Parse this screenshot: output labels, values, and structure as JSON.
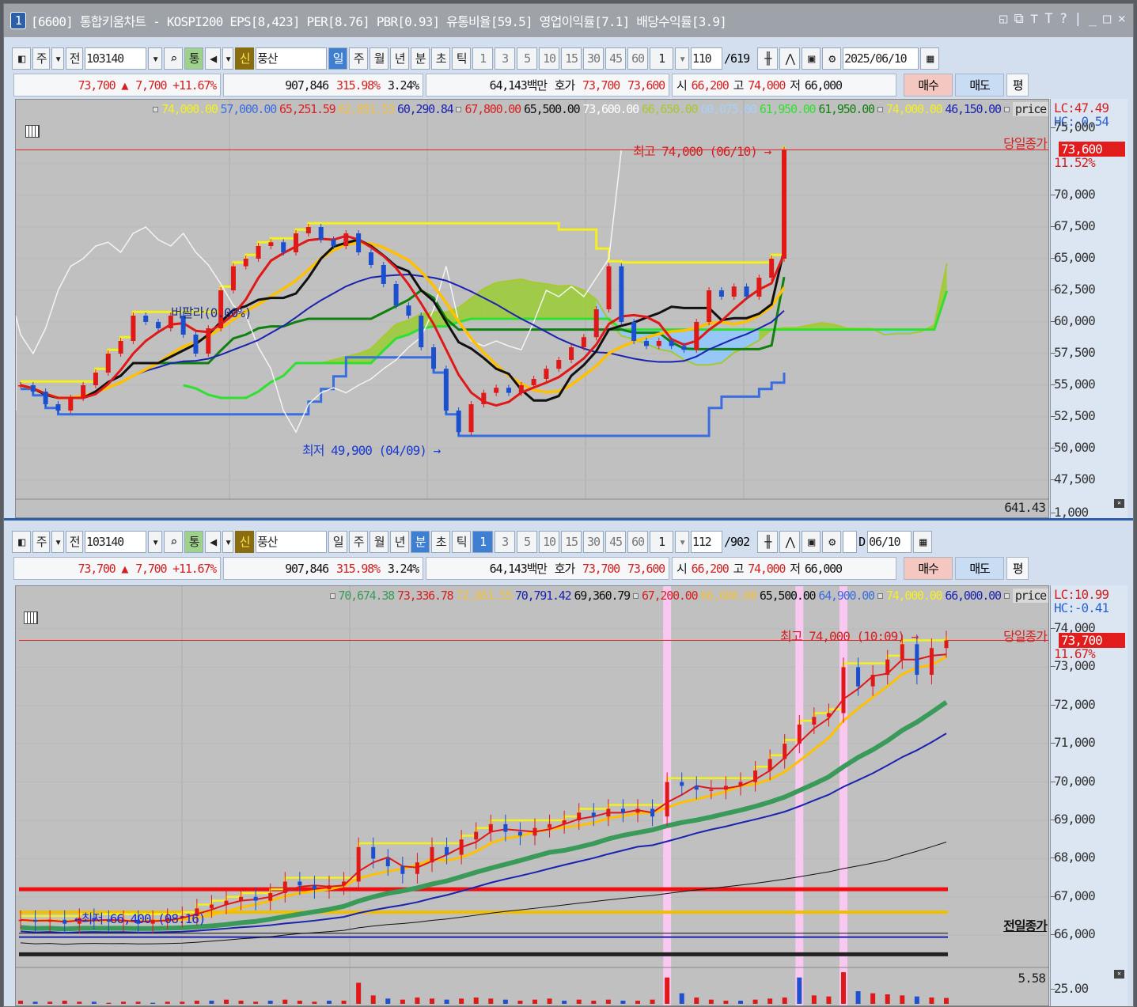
{
  "title": {
    "num": "1",
    "text": "[6600] 통합키움차트 - KOSPI200 EPS[8,423] PER[8.76] PBR[0.93] 유통비율[59.5] 영업이익률[7.1] 배당수익률[3.9]",
    "controls": [
      "◱",
      "⧉",
      "⊤",
      "T",
      "?",
      "|",
      "_",
      "□",
      "×"
    ]
  },
  "top": {
    "toolbar": {
      "market": "주",
      "all": "전",
      "code": "103140",
      "tong": "통",
      "sin": "신",
      "name": "풍산",
      "periods": [
        "일",
        "주",
        "월",
        "년",
        "분",
        "초",
        "틱"
      ],
      "selected_period": "일",
      "nums": [
        "1",
        "3",
        "5",
        "10",
        "15",
        "30",
        "45",
        "60"
      ],
      "unit": "1",
      "count": "110",
      "total": "/619",
      "date": "2025/06/10"
    },
    "info": {
      "price": "73,700 ▲",
      "change": "7,700 +11.67%",
      "volume": "907,846",
      "vol_ratio": "315.98%",
      "turnover": "3.24%",
      "amount": "64,143백만",
      "hoga_label": "호가",
      "ask": "73,700",
      "bid": "73,600",
      "open_label": "시",
      "open": "66,200",
      "high_label": "고",
      "high": "74,000",
      "low_label": "저",
      "low": "66,000",
      "buy": "매수",
      "sell": "매도",
      "avg": "평"
    },
    "legend": [
      {
        "sq": true,
        "v": "74,000.00",
        "c": "#f4f020"
      },
      {
        "v": "57,000.00",
        "c": "#3a6ee0"
      },
      {
        "v": "65,251.59",
        "c": "#d82020"
      },
      {
        "v": "62,851.53",
        "c": "#f0c040"
      },
      {
        "v": "60,290.84",
        "c": "#1a22b0"
      },
      {
        "sq": true,
        "v": "67,800.00",
        "c": "#d82020"
      },
      {
        "v": "65,500.00",
        "c": "#111111"
      },
      {
        "v": "73,600.00",
        "c": "#ffffff"
      },
      {
        "v": "66,650.00",
        "c": "#a8c830"
      },
      {
        "v": "60,075.00",
        "c": "#a8d0f8"
      },
      {
        "v": "61,950.00",
        "c": "#30e030"
      },
      {
        "v": "61,950.00",
        "c": "#108010"
      },
      {
        "sq": true,
        "v": "74,000.00",
        "c": "#f4f020"
      },
      {
        "v": "46,150.00",
        "c": "#1a22b0"
      },
      {
        "sq": true,
        "v": "price",
        "c": "#222222"
      }
    ],
    "lc": "LC:47.49",
    "hc": "HC:-0.54",
    "axis": [
      "75,000",
      "70,000",
      "67,500",
      "65,000",
      "62,500",
      "60,000",
      "57,500",
      "55,000",
      "52,500",
      "50,000",
      "47,500",
      "1,000"
    ],
    "price_tag": "73,600",
    "pct": "11.52%",
    "close_label": "당일종가",
    "high_ann": "최고 74,000 (06/10) →",
    "low_ann": "최저 49,900 (04/09) →",
    "indicator_ann": "버팔라(0.00%)",
    "sub_value": "641.43"
  },
  "bottom": {
    "toolbar": {
      "market": "주",
      "all": "전",
      "code": "103140",
      "tong": "통",
      "sin": "신",
      "name": "풍산",
      "periods": [
        "일",
        "주",
        "월",
        "년",
        "분",
        "초",
        "틱"
      ],
      "selected_period": "분",
      "nums": [
        "1",
        "3",
        "5",
        "10",
        "15",
        "30",
        "45",
        "60"
      ],
      "selected_num": "1",
      "unit": "1",
      "count": "112",
      "total": "/902",
      "d_label": "D",
      "date": "06/10"
    },
    "info": {
      "price": "73,700 ▲",
      "change": "7,700 +11.67%",
      "volume": "907,846",
      "vol_ratio": "315.98%",
      "turnover": "3.24%",
      "amount": "64,143백만",
      "hoga_label": "호가",
      "ask": "73,700",
      "bid": "73,600",
      "open_label": "시",
      "open": "66,200",
      "high_label": "고",
      "high": "74,000",
      "low_label": "저",
      "low": "66,000",
      "buy": "매수",
      "sell": "매도",
      "avg": "평"
    },
    "legend": [
      {
        "sq": true,
        "v": "70,674.38",
        "c": "#3a9a5a"
      },
      {
        "v": "73,336.78",
        "c": "#d82020"
      },
      {
        "v": "72,861.55",
        "c": "#f0c040"
      },
      {
        "v": "70,791.42",
        "c": "#1a22b0"
      },
      {
        "v": "69,360.79",
        "c": "#111111"
      },
      {
        "sq": true,
        "v": "67,200.00",
        "c": "#d82020"
      },
      {
        "v": "66,600.00",
        "c": "#f0c040"
      },
      {
        "v": "65,500.00",
        "c": "#111111"
      },
      {
        "v": "64,900.00",
        "c": "#3a6ee0"
      },
      {
        "sq": true,
        "v": "74,000.00",
        "c": "#f4f020"
      },
      {
        "v": "66,000.00",
        "c": "#1a22b0"
      },
      {
        "sq": true,
        "v": "price",
        "c": "#222222"
      }
    ],
    "lc": "LC:10.99",
    "hc": "HC:-0.41",
    "axis": [
      "74,000",
      "73,000",
      "72,000",
      "71,000",
      "70,000",
      "69,000",
      "68,000",
      "67,000",
      "66,000"
    ],
    "vol_axis": "25.00",
    "vol_value": "5.58",
    "price_tag": "73,700",
    "pct": "11.67%",
    "close_label": "당일종가",
    "high_ann": "최고 74,000 (10:09) →",
    "low_ann": "←최저 66,400 (08:16)",
    "prev_close_label": "전일종가"
  },
  "chart_data": [
    {
      "type": "candlestick",
      "name": "daily",
      "closes": [
        55000,
        54500,
        53500,
        53000,
        54000,
        55000,
        56000,
        57500,
        58500,
        60500,
        60000,
        59500,
        60500,
        59000,
        57500,
        59500,
        62500,
        64400,
        65000,
        66000,
        66300,
        65500,
        67000,
        67500,
        66500,
        66000,
        67000,
        65500,
        64500,
        63000,
        61300,
        60500,
        58000,
        56300,
        53000,
        51300,
        53500,
        54400,
        54800,
        54400,
        55000,
        55500,
        56300,
        57000,
        58000,
        58800,
        61000,
        64400,
        60000,
        58500,
        58100,
        58500,
        58100,
        57800,
        60000,
        62500,
        62000,
        62800,
        62000,
        63500,
        65000,
        73600
      ],
      "ylim": [
        46500,
        75500
      ],
      "hlines": [
        {
          "v": 73600,
          "c": "#e02020"
        }
      ]
    },
    {
      "type": "candlestick",
      "name": "1-minute",
      "closes": [
        66400,
        66350,
        66400,
        66300,
        66450,
        66400,
        66350,
        66400,
        66300,
        66400,
        66450,
        66500,
        66700,
        66800,
        66900,
        67000,
        66900,
        67100,
        67400,
        67300,
        67200,
        67300,
        67400,
        68300,
        68000,
        67800,
        67600,
        67900,
        68300,
        68100,
        68500,
        68700,
        68900,
        68700,
        68600,
        68800,
        68900,
        69000,
        69200,
        69100,
        69300,
        69200,
        69300,
        69100,
        70000,
        69900,
        69800,
        69800,
        69900,
        70000,
        70300,
        70600,
        71000,
        71500,
        71700,
        71800,
        73000,
        72500,
        72800,
        73200,
        73600,
        72800,
        73500,
        73700
      ],
      "volume": [
        3,
        2,
        2,
        3,
        2,
        2,
        1,
        2,
        2,
        1,
        2,
        2,
        3,
        3,
        4,
        3,
        2,
        3,
        4,
        3,
        2,
        3,
        3,
        20,
        8,
        5,
        4,
        6,
        5,
        4,
        5,
        6,
        5,
        4,
        3,
        4,
        5,
        3,
        4,
        3,
        4,
        3,
        3,
        4,
        25,
        10,
        6,
        4,
        3,
        3,
        4,
        5,
        6,
        25,
        8,
        7,
        30,
        12,
        10,
        9,
        8,
        7,
        6,
        5.58
      ],
      "highlight_bars": [
        44,
        53,
        56
      ],
      "ylim": [
        65000,
        74500
      ],
      "hlines": [
        {
          "v": 73700,
          "c": "#e02020",
          "w": 1
        },
        {
          "v": 67200,
          "c": "#ee1010",
          "w": 5
        },
        {
          "v": 66600,
          "c": "#f0c000",
          "w": 4
        },
        {
          "v": 66050,
          "c": "#111111",
          "w": 1
        },
        {
          "v": 65950,
          "c": "#1a22b0",
          "w": 2
        },
        {
          "v": 65500,
          "c": "#222222",
          "w": 5
        }
      ]
    }
  ]
}
